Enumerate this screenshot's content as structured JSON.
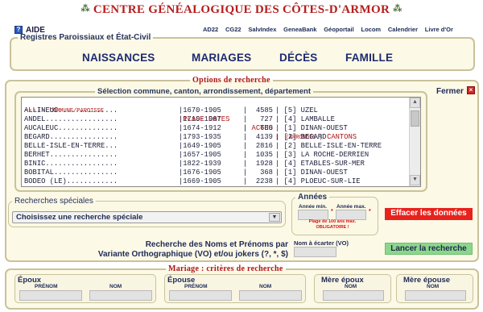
{
  "header": {
    "title": "CENTRE GÉNÉALOGIQUE DES CÔTES-D'ARMOR",
    "help_label": "AIDE",
    "links": [
      "AD22",
      "CG22",
      "SalvIndex",
      "GeneaBank",
      "Géoportail",
      "Locom",
      "Calendrier",
      "Livre d'Or"
    ]
  },
  "registres": {
    "legend": "Registres Paroissiaux et État-Civil",
    "items": [
      "NAISSANCES",
      "MARIAGES",
      "DÉCÈS",
      "FAMILLE"
    ]
  },
  "options": {
    "legend": "Options de recherche",
    "close_label": "Fermer",
    "close_icon": "close-x-icon",
    "selection_legend": "Sélection commune, canton, arrondissement, département",
    "list_header": {
      "commune_prefix": "-----",
      "commune": "COMMUNE/PAROISSE",
      "dates": "|PLAGE DATES",
      "actes": "| ACTES",
      "cantons_prefix": "|  (ARRONDIS.)",
      "cantons": "CANTONS"
    },
    "communes": [
      {
        "name": "ALLINEUC..............",
        "dates": "|1670-1905",
        "actes": "|  4585",
        "canton": "| [5] UZEL"
      },
      {
        "name": "ANDEL.................",
        "dates": "|1710-1907",
        "actes": "|   727",
        "canton": "| [4] LAMBALLE"
      },
      {
        "name": "AUCALEUC..............",
        "dates": "|1674-1912",
        "actes": "|   680",
        "canton": "| [1] DINAN-OUEST"
      },
      {
        "name": "BEGARD................",
        "dates": "|1793-1935",
        "actes": "|  4139",
        "canton": "| [2] BEGARD"
      },
      {
        "name": "BELLE-ISLE-EN-TERRE...",
        "dates": "|1649-1905",
        "actes": "|  2816",
        "canton": "| [2] BELLE-ISLE-EN-TERRE"
      },
      {
        "name": "BERHET................",
        "dates": "|1657-1905",
        "actes": "|  1035",
        "canton": "| [3] LA ROCHE-DERRIEN"
      },
      {
        "name": "BINIC.................",
        "dates": "|1822-1939",
        "actes": "|  1928",
        "canton": "| [4] ETABLES-SUR-MER"
      },
      {
        "name": "BOBITAL...............",
        "dates": "|1676-1905",
        "actes": "|   368",
        "canton": "| [1] DINAN-OUEST"
      },
      {
        "name": "BODEO (LE)............",
        "dates": "|1669-1905",
        "actes": "|  2238",
        "canton": "| [4] PLOEUC-SUR-LIE"
      }
    ],
    "recherches_legend": "Recherches spéciales",
    "recherches_select": "Choisissez une recherche spéciale",
    "annees_legend": "Années",
    "annee_min_label": "Année min.",
    "annee_max_label": "Année max.",
    "plage_note_1": "Plage de 100 ans max.",
    "plage_note_2": "OBLIGATOIRE !",
    "clear_button": "Effacer les données",
    "noms_label_1": "Recherche des Noms et Prénoms par",
    "noms_label_2": "Variante Orthographique (VO) et/ou jokers (?, *, $)",
    "ecarter_label": "Nom à écarter (VO)",
    "search_button": "Lancer la recherche"
  },
  "mariage": {
    "legend": "Mariage : critères de recherche",
    "epoux": {
      "title": "Époux",
      "prenom": "PRÉNOM",
      "nom": "NOM"
    },
    "epouse": {
      "title": "Épouse",
      "prenom": "PRÉNOM",
      "nom": "NOM"
    },
    "mere_epoux": {
      "title": "Mère époux",
      "nom": "NOM"
    },
    "mere_epouse": {
      "title": "Mère épouse",
      "nom": "NOM"
    }
  },
  "colors": {
    "title_red": "#b41e1e",
    "panel_bg": "#fcf9e6",
    "panel_border": "#c9c29b",
    "nav_blue": "#1e2a70",
    "clear_red": "#e8221c",
    "search_green": "#8cd68c"
  }
}
